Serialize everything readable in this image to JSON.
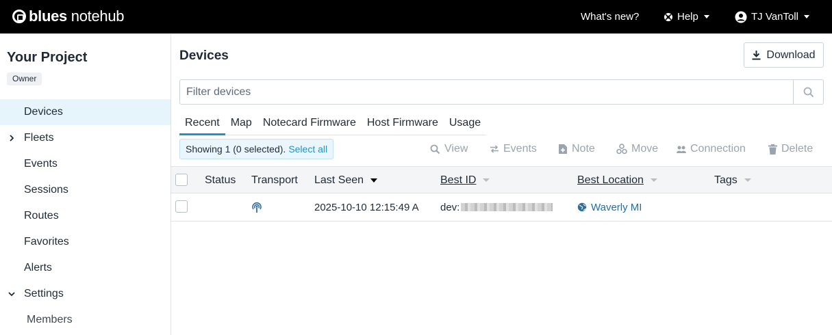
{
  "topbar": {
    "logo_bold": "blues",
    "logo_rest": " notehub",
    "whats_new": "What's new?",
    "help": "Help",
    "user": "TJ VanToll"
  },
  "sidebar": {
    "project_title": "Your Project",
    "role_badge": "Owner",
    "items": [
      {
        "label": "Devices"
      },
      {
        "label": "Fleets"
      },
      {
        "label": "Events"
      },
      {
        "label": "Sessions"
      },
      {
        "label": "Routes"
      },
      {
        "label": "Favorites"
      },
      {
        "label": "Alerts"
      },
      {
        "label": "Settings"
      },
      {
        "label": "Members"
      }
    ]
  },
  "main": {
    "title": "Devices",
    "download_label": "Download",
    "filter_placeholder": "Filter devices",
    "tabs": [
      {
        "label": "Recent"
      },
      {
        "label": "Map"
      },
      {
        "label": "Notecard Firmware"
      },
      {
        "label": "Host Firmware"
      },
      {
        "label": "Usage"
      }
    ],
    "selection_text": "Showing 1 (0 selected).",
    "select_all": "Select all",
    "actions": {
      "view": "View",
      "events": "Events",
      "note": "Note",
      "move": "Move",
      "connection": "Connection",
      "delete": "Delete"
    }
  },
  "table": {
    "columns": {
      "status": "Status",
      "transport": "Transport",
      "last_seen": "Last Seen",
      "best_id": "Best ID",
      "best_location": "Best Location",
      "tags": "Tags"
    },
    "rows": [
      {
        "transport_icon": "cellular-icon",
        "last_seen": "2025-10-10 12:15:49 A",
        "best_id_prefix": "dev:",
        "best_location": "Waverly MI"
      }
    ]
  },
  "colors": {
    "accent": "#1c95c6",
    "topbar": "#000000",
    "active_nav": "#e6f4fb",
    "disabled_action": "#9aa4ae"
  }
}
